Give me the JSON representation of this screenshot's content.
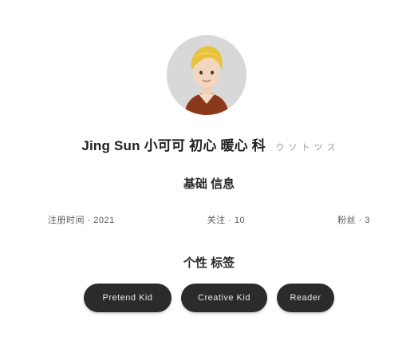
{
  "profile": {
    "name": "Jing Sun 小可可 初心 暖心 科",
    "name_hint": "ウ ソ ト ツ ス",
    "avatar_icon": "user-avatar-icon"
  },
  "info_section": {
    "title": "基础 信息",
    "stats": [
      {
        "label": "注册时间 · 2021"
      },
      {
        "label": "关注 · 10"
      },
      {
        "label": "粉丝 · 3"
      }
    ]
  },
  "tags_section": {
    "title": "个性 标签",
    "tags": [
      {
        "label": "Pretend Kid"
      },
      {
        "label": "Creative Kid"
      },
      {
        "label": "Reader"
      }
    ]
  },
  "colors": {
    "pill_bg": "#2b2b2b",
    "avatar_bg": "#d8d8d8",
    "hair": "#e8c23a",
    "shirt": "#8a3a1a"
  }
}
